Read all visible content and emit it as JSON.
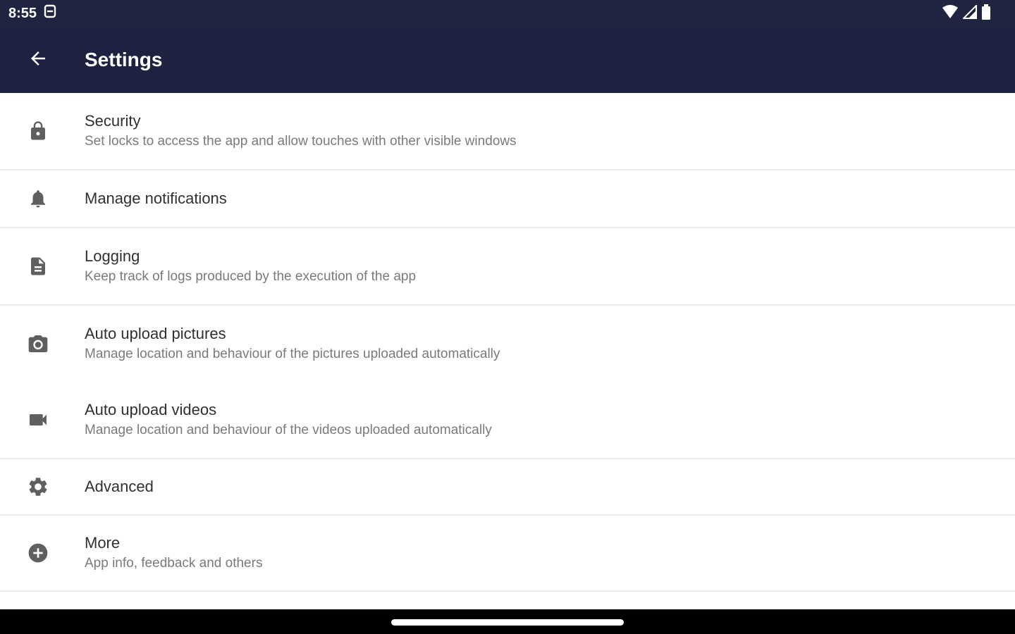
{
  "status_bar": {
    "time": "8:55",
    "icons": [
      "storage-icon",
      "wifi-icon",
      "cell-signal-icon",
      "battery-icon"
    ]
  },
  "app_bar": {
    "title": "Settings",
    "back_icon": "arrow-back-icon"
  },
  "colors": {
    "app_bar_bg": "#1c2240",
    "status_bar_bg": "#1f2440",
    "title_text": "#303030",
    "summary_text": "#7a7a7a",
    "icon": "#5f5f5f"
  },
  "settings": {
    "items": [
      {
        "icon": "lock-icon",
        "title": "Security",
        "summary": "Set locks to access the app and allow touches with other visible windows"
      },
      {
        "icon": "bell-icon",
        "title": "Manage notifications",
        "summary": ""
      },
      {
        "icon": "file-icon",
        "title": "Logging",
        "summary": "Keep track of logs produced by the execution of the app"
      },
      {
        "icon": "camera-icon",
        "title": "Auto upload pictures",
        "summary": "Manage location and behaviour of the pictures uploaded automatically"
      },
      {
        "icon": "videocam-icon",
        "title": "Auto upload videos",
        "summary": "Manage location and behaviour of the videos uploaded automatically"
      },
      {
        "icon": "gear-icon",
        "title": "Advanced",
        "summary": ""
      },
      {
        "icon": "add-circle-icon",
        "title": "More",
        "summary": "App info, feedback and others"
      }
    ]
  }
}
